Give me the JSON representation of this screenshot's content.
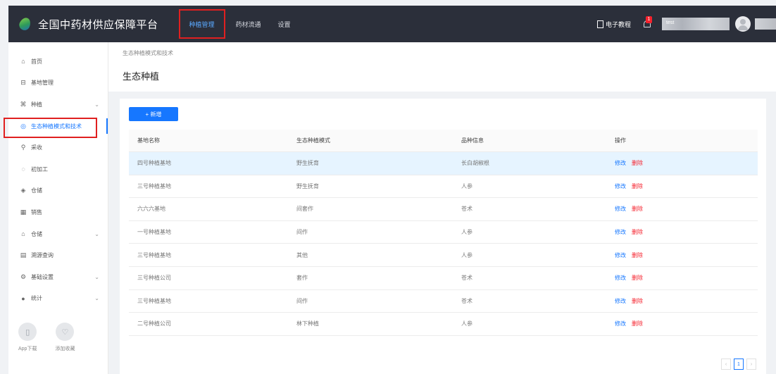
{
  "header": {
    "app_title": "全国中药材供应保障平台",
    "nav": [
      {
        "label": "种植管理"
      },
      {
        "label": "药材流通"
      },
      {
        "label": "设置"
      }
    ],
    "doc_link": "电子教程",
    "notification_count": "1",
    "user_blur": "test"
  },
  "sidebar": {
    "items": [
      {
        "icon": "⌂",
        "label": "首页"
      },
      {
        "icon": "⊟",
        "label": "基地管理"
      },
      {
        "icon": "⌘",
        "label": "种植",
        "arrow": "⌄"
      },
      {
        "icon": "◎",
        "label": "生态种植模式和技术"
      },
      {
        "icon": "⚲",
        "label": "采收"
      },
      {
        "icon": "◌",
        "label": "初加工"
      },
      {
        "icon": "◈",
        "label": "仓储"
      },
      {
        "icon": "▦",
        "label": "销售"
      },
      {
        "icon": "⌂",
        "label": "仓储",
        "arrow": "⌄"
      },
      {
        "icon": "▤",
        "label": "溯源查询"
      },
      {
        "icon": "⚙",
        "label": "基础设置",
        "arrow": "⌄"
      },
      {
        "icon": "●",
        "label": "统计",
        "arrow": "⌄"
      }
    ],
    "bottom": [
      {
        "icon": "▯",
        "label": "App下载"
      },
      {
        "icon": "♡",
        "label": "添加收藏"
      }
    ]
  },
  "page": {
    "breadcrumb": "生态种植模式和技术",
    "title": "生态种植"
  },
  "toolbar": {
    "new_label": "+ 新增"
  },
  "table": {
    "columns": [
      "基地名称",
      "生态种植模式",
      "品种信息",
      "操作"
    ],
    "edit_label": "修改",
    "delete_label": "删除",
    "rows": [
      {
        "base": "四号种植基地",
        "mode": "野生抚育",
        "variety": "长白胡椒根",
        "highlight": true
      },
      {
        "base": "三号种植基地",
        "mode": "野生抚育",
        "variety": "人参"
      },
      {
        "base": "六六六基地",
        "mode": "间套作",
        "variety": "苍术"
      },
      {
        "base": "一号种植基地",
        "mode": "间作",
        "variety": "人参"
      },
      {
        "base": "三号种植基地",
        "mode": "其他",
        "variety": "人参"
      },
      {
        "base": "三号种植公司",
        "mode": "套作",
        "variety": "苍术"
      },
      {
        "base": "三号种植基地",
        "mode": "间作",
        "variety": "苍术"
      },
      {
        "base": "二号种植公司",
        "mode": "林下种植",
        "variety": "人参"
      }
    ]
  },
  "pagination": {
    "prev": "‹",
    "current": "1",
    "next": "›"
  }
}
